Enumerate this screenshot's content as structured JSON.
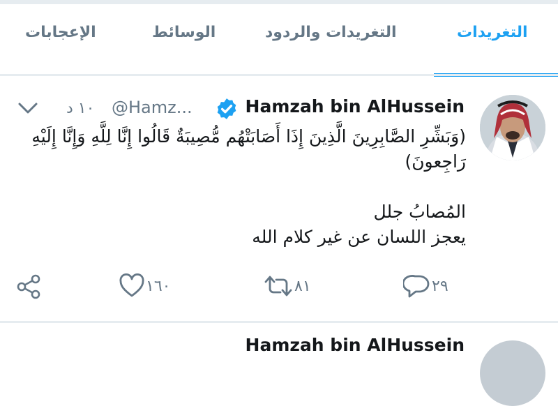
{
  "tabs": [
    {
      "label": "التغريدات",
      "active": true
    },
    {
      "label": "التغريدات والردود",
      "active": false
    },
    {
      "label": "الوسائط",
      "active": false
    },
    {
      "label": "الإعجابات",
      "active": false
    }
  ],
  "tweet": {
    "author_name": "Hamzah bin AlHussein",
    "handle": "@Hamz...",
    "time": "١٠ د",
    "verified": true,
    "lines": [
      "(وَبَشِّرِ الصَّابِرِينَ الَّذِينَ إِذَا أَصَابَتْهُم مُّصِيبَةٌ قَالُوا إِنَّا لِلَّهِ وَإِنَّا إِلَيْهِ رَاجِعونَ)",
      "",
      "المُصابُ جلل",
      "يعجز اللسان عن غير كلام الله"
    ],
    "actions": {
      "replies": "٢٩",
      "retweets": "٨١",
      "likes": "١٦٠"
    }
  },
  "next_tweet_preview": {
    "author_name": "Hamzah bin AlHussein"
  },
  "colors": {
    "accent": "#1da1f2",
    "muted": "#657786",
    "divider": "#e6ecf0"
  }
}
